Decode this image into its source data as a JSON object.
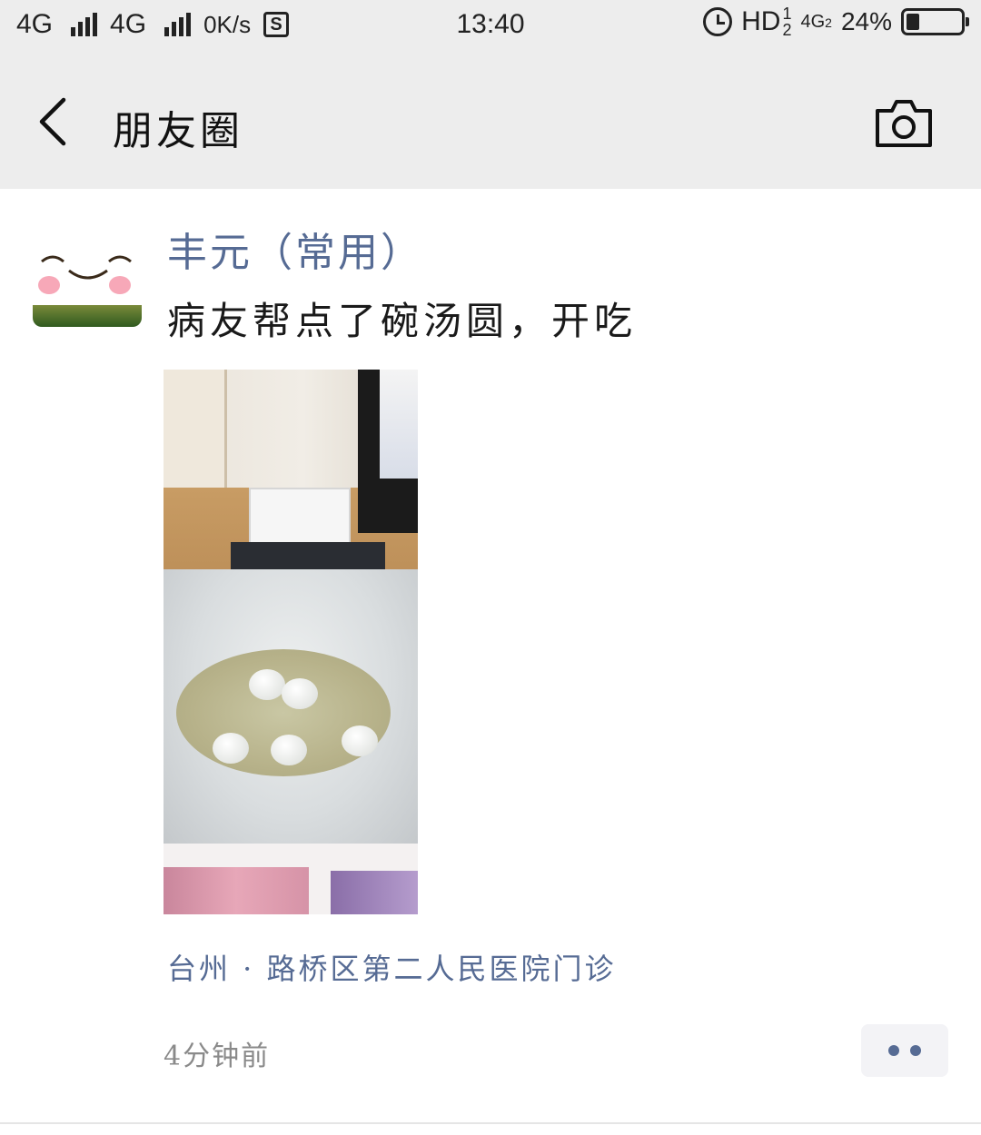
{
  "status_bar": {
    "network_1": "4G",
    "network_2": "4G",
    "speed": "0K/s",
    "s_icon": "S",
    "time": "13:40",
    "hd_label": "HD",
    "hd_sup": "1",
    "hd_sub": "2",
    "network_3": "4G",
    "network_3_sub": "2",
    "battery": "24%",
    "battery_level": 0.24,
    "icons": [
      "signal-icon",
      "alarm-icon",
      "battery-icon"
    ]
  },
  "nav": {
    "title": "朋友圈",
    "back_icon": "chevron-left-icon",
    "camera_icon": "camera-icon"
  },
  "post": {
    "author": "丰元（常用）",
    "text": "病友帮点了碗汤圆，开吃",
    "location": "台州 · 路桥区第二人民医院门诊",
    "time_ago": "4分钟前",
    "more_icon": "more-dots-icon"
  },
  "colors": {
    "link": "#566b94",
    "header_bg": "#ededed",
    "meta_gray": "#8a8a8a"
  }
}
